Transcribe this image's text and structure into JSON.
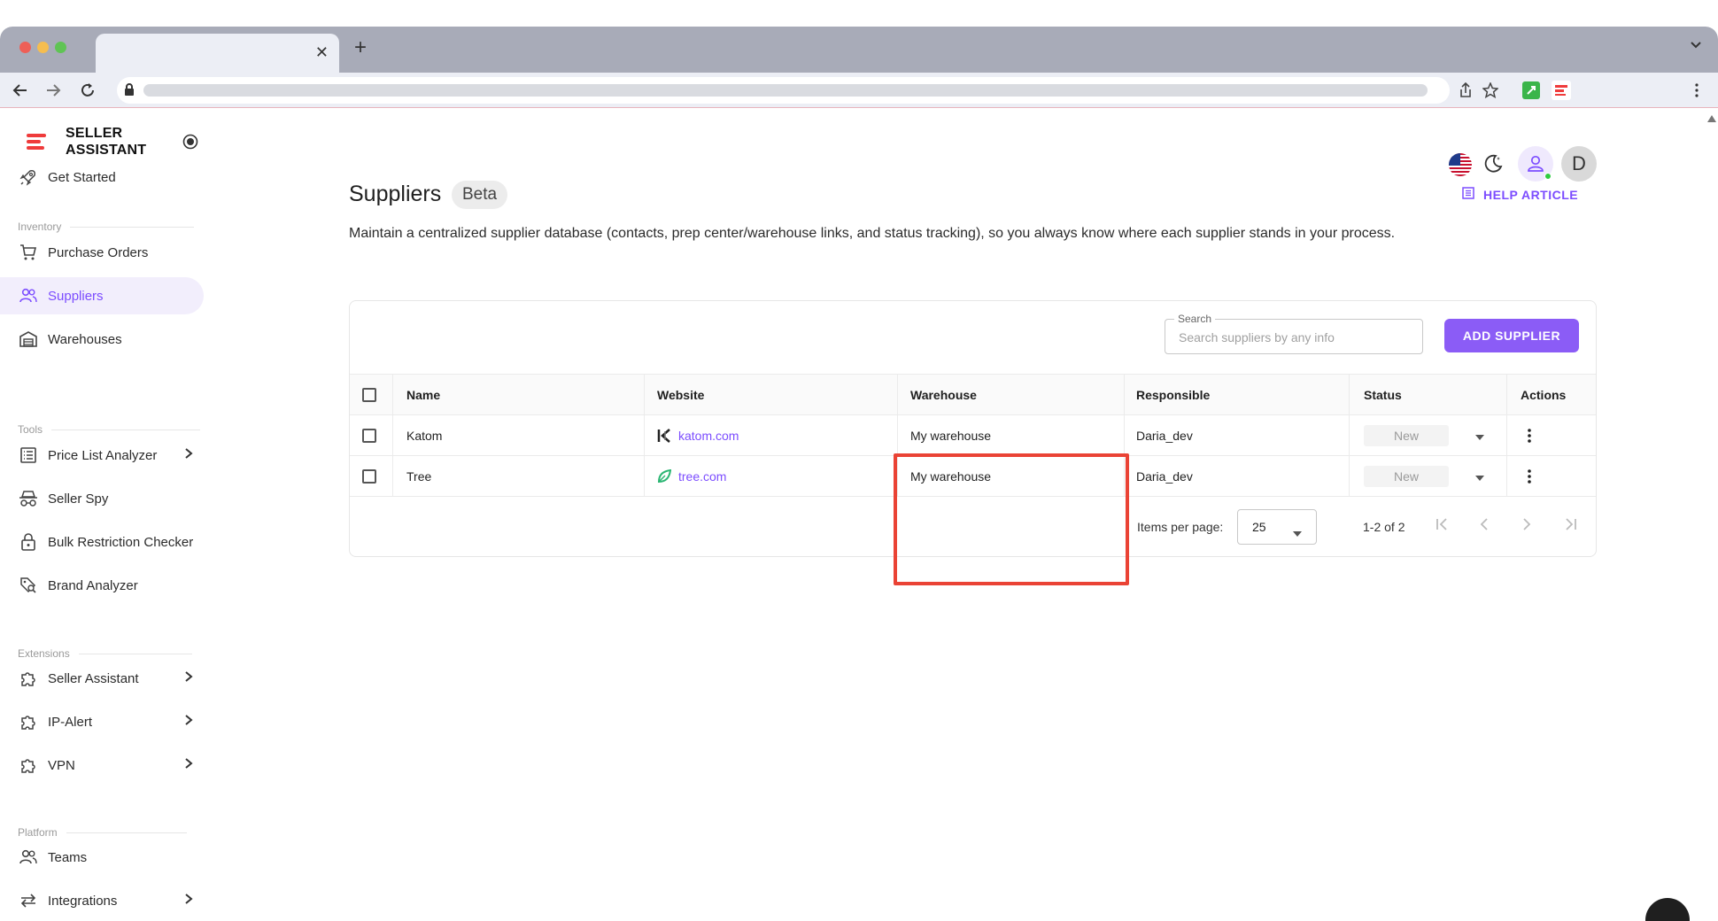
{
  "browser": {
    "tab_title": "",
    "tab_close": "✕",
    "new_tab": "+"
  },
  "brand": {
    "line1": "SELLER",
    "line2": "ASSISTANT"
  },
  "sidebar": {
    "get_started": "Get Started",
    "sections": {
      "inventory": "Inventory",
      "tools": "Tools",
      "extensions": "Extensions",
      "platform": "Platform"
    },
    "items": {
      "purchase_orders": "Purchase Orders",
      "suppliers": "Suppliers",
      "warehouses": "Warehouses",
      "price_list_analyzer": "Price List Analyzer",
      "seller_spy": "Seller Spy",
      "bulk_restriction_checker": "Bulk Restriction Checker",
      "brand_analyzer": "Brand Analyzer",
      "seller_assistant": "Seller Assistant",
      "ip_alert": "IP-Alert",
      "vpn": "VPN",
      "teams": "Teams",
      "integrations": "Integrations"
    }
  },
  "header": {
    "avatar_initial": "D"
  },
  "page": {
    "title": "Suppliers",
    "badge": "Beta",
    "help_label": "HELP ARTICLE",
    "description": "Maintain a centralized supplier database (contacts, prep center/warehouse links, and status tracking), so you always know where each supplier stands in your process."
  },
  "search": {
    "label": "Search",
    "placeholder": "Search suppliers by any info"
  },
  "add_button": "ADD SUPPLIER",
  "table": {
    "columns": {
      "name": "Name",
      "website": "Website",
      "warehouse": "Warehouse",
      "responsible": "Responsible",
      "status": "Status",
      "actions": "Actions"
    },
    "rows": [
      {
        "name": "Katom",
        "website": "katom.com",
        "warehouse": "My warehouse",
        "responsible": "Daria_dev",
        "status": "New"
      },
      {
        "name": "Tree",
        "website": "tree.com",
        "warehouse": "My warehouse",
        "responsible": "Daria_dev",
        "status": "New"
      }
    ]
  },
  "pagination": {
    "items_per_page_label": "Items per page:",
    "items_per_page": "25",
    "range": "1-2 of 2"
  },
  "colors": {
    "accent": "#8b5cf6",
    "highlight": "#ea4335",
    "brand_red": "#ef3b3b"
  }
}
